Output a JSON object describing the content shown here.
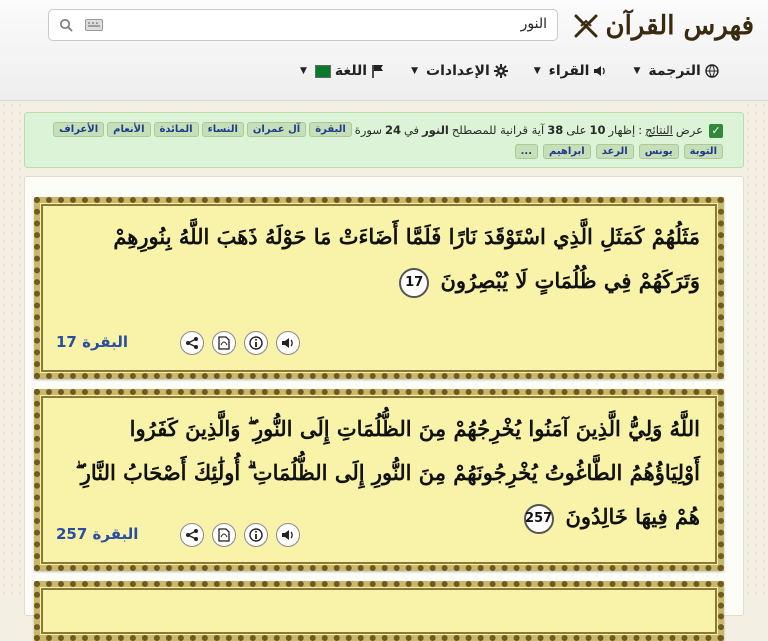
{
  "brand": {
    "title": "فهرس القرآن"
  },
  "search": {
    "query": "النور"
  },
  "nav": {
    "items": [
      {
        "label": "الترجمة",
        "icon": "globe-icon"
      },
      {
        "label": "القراء",
        "icon": "speaker-icon"
      },
      {
        "label": "الإعدادات",
        "icon": "gear-icon"
      },
      {
        "label": "اللغة",
        "icon": "flag-icon"
      }
    ]
  },
  "banner": {
    "prefix": "عرض",
    "results_word": "النتائج",
    "sep": ":",
    "showing": "إظهار",
    "shown_count": "10",
    "of": "على",
    "total_count": "38",
    "ayah_text": "آية قرانية للمصطلح",
    "term": "النور",
    "in": "في",
    "surah_count": "24",
    "surah_word": "سورة",
    "row1_tags": [
      "البقرة",
      "آل عمران",
      "النساء",
      "المائدة",
      "الأنعام",
      "الأعراف"
    ],
    "row2_tags": [
      "التوبة",
      "يونس",
      "الرعد",
      "ابراهيم",
      "..."
    ]
  },
  "verses": [
    {
      "text": "مَثَلُهُمْ كَمَثَلِ الَّذِي اسْتَوْقَدَ نَارًا فَلَمَّا أَضَاءَتْ مَا حَوْلَهُ ذَهَبَ اللَّهُ بِنُورِهِمْ وَتَرَكَهُمْ فِي ظُلُمَاتٍ لَا يُبْصِرُونَ",
      "number": "17",
      "reference": "البقرة 17"
    },
    {
      "text": "اللَّهُ وَلِيُّ الَّذِينَ آمَنُوا يُخْرِجُهُمْ مِنَ الظُّلُمَاتِ إِلَى النُّورِ ۖ وَالَّذِينَ كَفَرُوا أَوْلِيَاؤُهُمُ الطَّاغُوتُ يُخْرِجُونَهُمْ مِنَ النُّورِ إِلَى الظُّلُمَاتِ ۗ أُولَٰئِكَ أَصْحَابُ النَّارِ ۖ هُمْ فِيهَا خَالِدُونَ",
      "number": "257",
      "reference": "البقرة 257"
    }
  ]
}
